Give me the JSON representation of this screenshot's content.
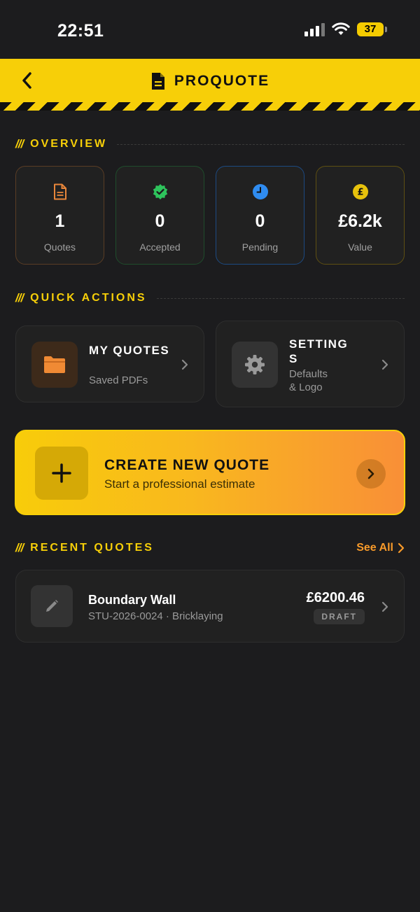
{
  "status_bar": {
    "time": "22:51",
    "battery": "37"
  },
  "header": {
    "title": "PROQUOTE"
  },
  "overview": {
    "title": "OVERVIEW",
    "stats": [
      {
        "value": "1",
        "label": "Quotes",
        "icon": "document-icon",
        "color": "#e8863a"
      },
      {
        "value": "0",
        "label": "Accepted",
        "icon": "check-badge-icon",
        "color": "#2ec45c"
      },
      {
        "value": "0",
        "label": "Pending",
        "icon": "clock-icon",
        "color": "#2f8cf0"
      },
      {
        "value": "£6.2k",
        "label": "Value",
        "icon": "pound-coin-icon",
        "color": "#e7c20c"
      }
    ]
  },
  "quick_actions": {
    "title": "QUICK ACTIONS",
    "my_quotes": {
      "title": "MY QUOTES",
      "subtitle": "Saved PDFs",
      "icon": "folder-icon"
    },
    "settings": {
      "title_line1": "SETTING",
      "title_line2": "S",
      "subtitle_line1": "Defaults",
      "subtitle_line2": "& Logo",
      "icon": "gear-icon"
    }
  },
  "create": {
    "title": "CREATE NEW QUOTE",
    "subtitle": "Start a professional estimate",
    "icon": "plus-icon"
  },
  "recent": {
    "title": "RECENT QUOTES",
    "see_all": "See All",
    "quotes": [
      {
        "title": "Boundary Wall",
        "meta": "STU-2026-0024 · Bricklaying",
        "amount": "£6200.46",
        "status": "DRAFT",
        "icon": "pencil-icon"
      }
    ]
  },
  "colors": {
    "accent": "#f7cf08",
    "orange": "#f79a2a",
    "background": "#1c1c1e",
    "card": "#212121"
  }
}
